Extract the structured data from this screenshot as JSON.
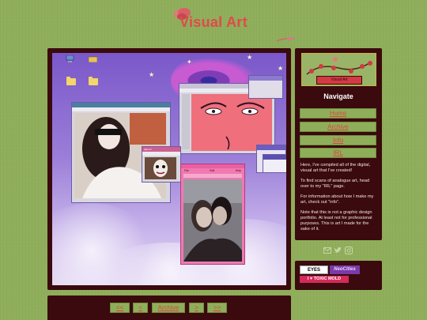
{
  "site": {
    "title": "Visual Art"
  },
  "nav": {
    "heading": "Navigate",
    "items": [
      {
        "label": "Home"
      },
      {
        "label": "Archive"
      },
      {
        "label": "Info"
      },
      {
        "label": "IRL"
      }
    ]
  },
  "banner": {
    "plate_text": "Visual Art"
  },
  "about": {
    "paragraphs": [
      "Here, I've compiled all of the digital, visual art that I've created!",
      "To find scans of analogue art, head over to my \"IRL\" page.",
      "For information about how I make my art, check out \"info\".",
      "Note that this is not a graphic design portfolio. At least not for professional purposes. This is art I made for the sake of it."
    ]
  },
  "social": [
    "mail-icon",
    "twitter-icon",
    "instagram-icon"
  ],
  "badges": {
    "eyes": "EYES",
    "neocities": "NeoCities",
    "toxic": "I ♥ TOXIC MOLD"
  },
  "pager": {
    "first": "<<",
    "prev": "<",
    "current": "Archive",
    "next": ">",
    "last": ">>"
  },
  "artwork": {
    "windows": {
      "small_title": "HELLO",
      "menu_file": "File",
      "menu_edit": "Edit",
      "menu_help": "Help"
    }
  },
  "colors": {
    "background": "#8fae5a",
    "panel": "#3a0a0e",
    "accent_red": "#e04a4a",
    "link": "#d9453f"
  }
}
